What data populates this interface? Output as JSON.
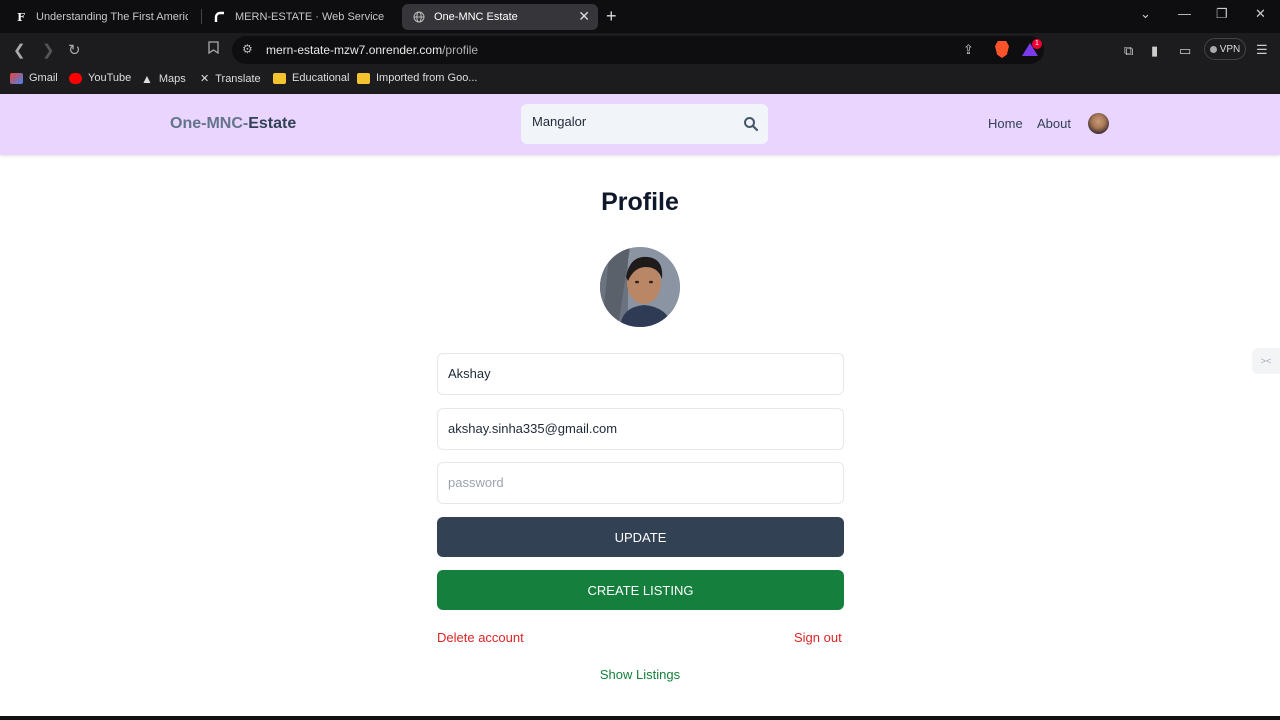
{
  "browser": {
    "tabs": [
      {
        "label": "Understanding The First American Fi",
        "favicon": "F",
        "active": false
      },
      {
        "label": "MERN-ESTATE · Web Service · Rend",
        "favicon": "render-icon",
        "active": false
      },
      {
        "label": "One-MNC Estate",
        "favicon": "globe-icon",
        "active": true
      }
    ],
    "url_host": "mern-estate-mzw7.onrender.com",
    "url_path": "/profile",
    "vpn_label": "VPN",
    "warn_count": "1",
    "bookmarks": [
      "Gmail",
      "YouTube",
      "Maps",
      "Translate",
      "Educational",
      "Imported from Goo..."
    ]
  },
  "header": {
    "logo_part1": "One-MNC-",
    "logo_part2": "Estate",
    "search_value": "Mangalor",
    "nav": {
      "home": "Home",
      "about": "About"
    }
  },
  "profile": {
    "title": "Profile",
    "username": "Akshay",
    "email": "akshay.sinha335@gmail.com",
    "password_placeholder": "password",
    "update_label": "UPDATE",
    "create_listing_label": "CREATE LISTING",
    "delete_account_label": "Delete account",
    "sign_out_label": "Sign out",
    "show_listings_label": "Show Listings"
  },
  "colors": {
    "header_bg": "#e9d5ff",
    "update_btn": "#334155",
    "create_btn": "#15803d",
    "danger": "#dc2626",
    "success": "#15803d"
  }
}
